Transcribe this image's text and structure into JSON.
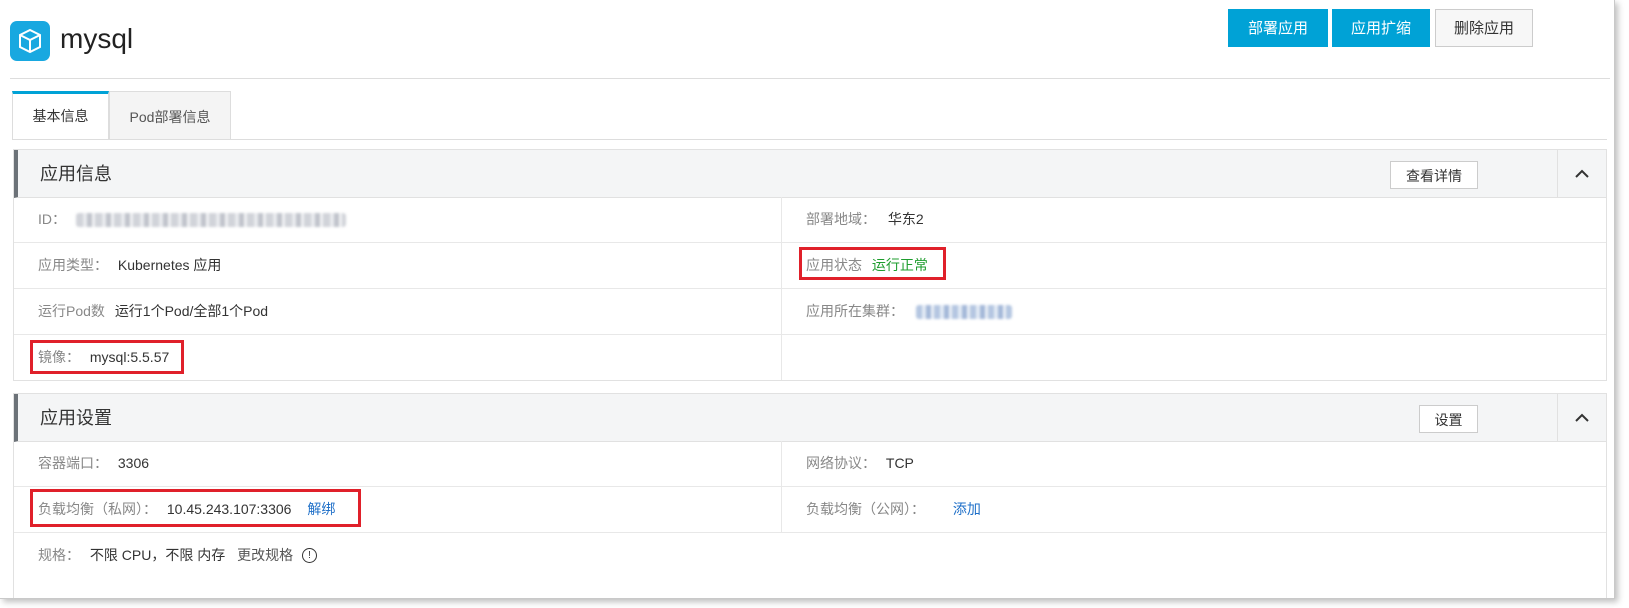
{
  "header": {
    "app_name": "mysql",
    "logo_icon": "cube-icon",
    "buttons": {
      "deploy": "部署应用",
      "scale": "应用扩缩",
      "delete": "删除应用"
    }
  },
  "tabs": [
    {
      "label": "基本信息",
      "active": true
    },
    {
      "label": "Pod部署信息",
      "active": false
    }
  ],
  "app_info": {
    "title": "应用信息",
    "detail_button": "查看详情",
    "id_label": "ID：",
    "region_label": "部署地域：",
    "region_value": "华东2",
    "type_label": "应用类型：",
    "type_value": "Kubernetes 应用",
    "status_label": "应用状态",
    "status_value": "运行正常",
    "pods_label": "运行Pod数",
    "pods_value": "运行1个Pod/全部1个Pod",
    "cluster_label": "应用所在集群：",
    "image_label": "镜像：",
    "image_value": "mysql:5.5.57"
  },
  "app_settings": {
    "title": "应用设置",
    "settings_button": "设置",
    "port_label": "容器端口：",
    "port_value": "3306",
    "protocol_label": "网络协议：",
    "protocol_value": "TCP",
    "slb_private_label": "负载均衡（私网）：",
    "slb_private_value": "10.45.243.107:3306",
    "slb_private_action": "解绑",
    "slb_public_label": "负载均衡（公网）：",
    "slb_public_action": "添加",
    "spec_label": "规格：",
    "spec_value": "不限 CPU，不限 内存",
    "spec_action": "更改规格",
    "info_glyph": "!"
  },
  "colors": {
    "primary": "#00a2d6",
    "status_ok": "#1e9d2e",
    "link": "#1e6fc8",
    "highlight": "#e0202a"
  }
}
